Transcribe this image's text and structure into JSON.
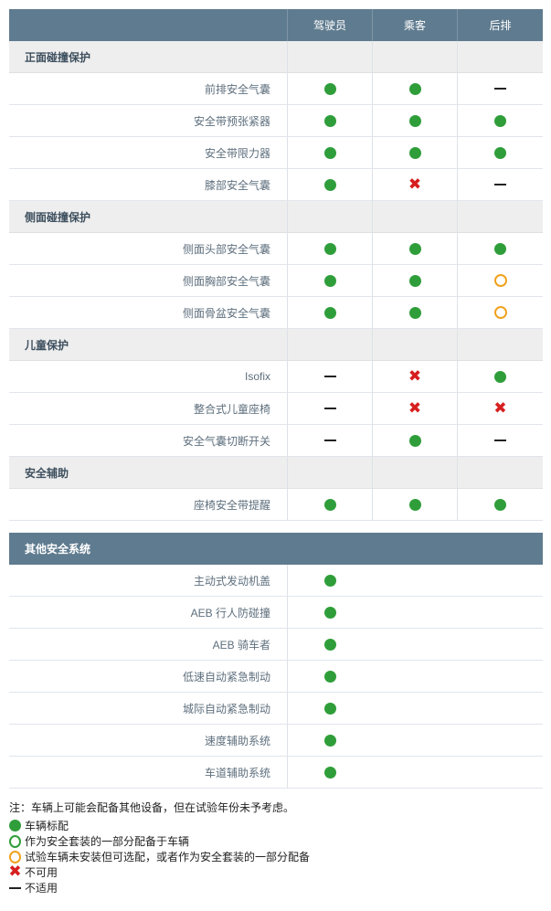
{
  "table": {
    "columns": [
      "驾驶员",
      "乘客",
      "后排"
    ],
    "sections": [
      {
        "title": "正面碰撞保护",
        "rows": [
          {
            "label": "前排安全气囊",
            "values": [
              "filled",
              "filled",
              "dash"
            ]
          },
          {
            "label": "安全带预张紧器",
            "values": [
              "filled",
              "filled",
              "filled"
            ]
          },
          {
            "label": "安全带限力器",
            "values": [
              "filled",
              "filled",
              "filled"
            ]
          },
          {
            "label": "膝部安全气囊",
            "values": [
              "filled",
              "x",
              "dash"
            ]
          }
        ]
      },
      {
        "title": "侧面碰撞保护",
        "rows": [
          {
            "label": "侧面头部安全气囊",
            "values": [
              "filled",
              "filled",
              "filled"
            ]
          },
          {
            "label": "侧面胸部安全气囊",
            "values": [
              "filled",
              "filled",
              "open-orange"
            ]
          },
          {
            "label": "侧面骨盆安全气囊",
            "values": [
              "filled",
              "filled",
              "open-orange"
            ]
          }
        ]
      },
      {
        "title": "儿童保护",
        "rows": [
          {
            "label": "Isofix",
            "values": [
              "dash",
              "x",
              "filled"
            ]
          },
          {
            "label": "整合式儿童座椅",
            "values": [
              "dash",
              "x",
              "x"
            ]
          },
          {
            "label": "安全气囊切断开关",
            "values": [
              "dash",
              "filled",
              "dash"
            ]
          }
        ]
      },
      {
        "title": "安全辅助",
        "rows": [
          {
            "label": "座椅安全带提醒",
            "values": [
              "filled",
              "filled",
              "filled"
            ]
          }
        ]
      }
    ]
  },
  "other": {
    "title": "其他安全系统",
    "rows": [
      {
        "label": "主动式发动机盖",
        "value": "filled"
      },
      {
        "label": "AEB 行人防碰撞",
        "value": "filled"
      },
      {
        "label": "AEB 骑车者",
        "value": "filled"
      },
      {
        "label": "低速自动紧急制动",
        "value": "filled"
      },
      {
        "label": "城际自动紧急制动",
        "value": "filled"
      },
      {
        "label": "速度辅助系统",
        "value": "filled"
      },
      {
        "label": "车道辅助系统",
        "value": "filled"
      }
    ]
  },
  "note": "注：车辆上可能会配备其他设备，但在试验年份未予考虑。",
  "legend": [
    {
      "icon": "filled",
      "text": "车辆标配"
    },
    {
      "icon": "open-green",
      "text": "作为安全套装的一部分配备于车辆"
    },
    {
      "icon": "open-orange",
      "text": "试验车辆未安装但可选配，或者作为安全套装的一部分配备"
    },
    {
      "icon": "x",
      "text": "不可用"
    },
    {
      "icon": "dash",
      "text": "不适用"
    }
  ],
  "colors": {
    "header_bg": "#5f7b8f",
    "section_bg": "#eeeeee",
    "green": "#2f9e3a",
    "orange": "#f0a21e",
    "red": "#d71f1f"
  }
}
